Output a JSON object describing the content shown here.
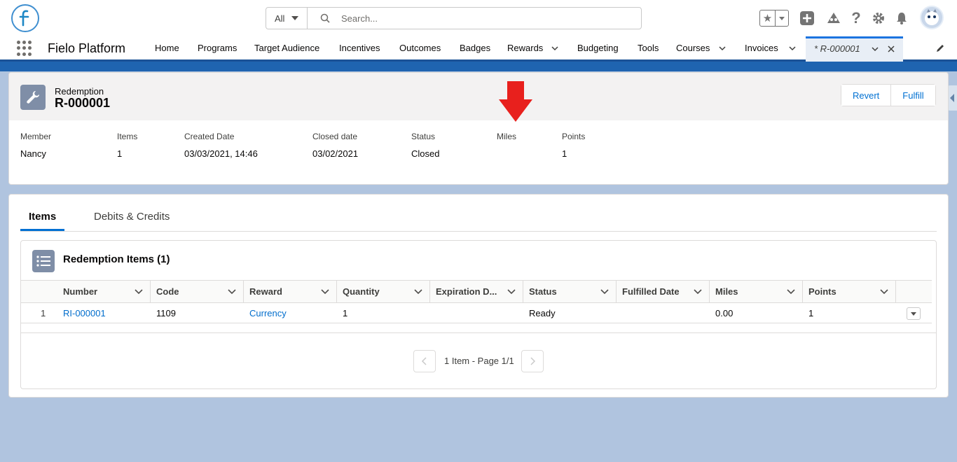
{
  "header": {
    "search_scope": "All",
    "search_placeholder": "Search..."
  },
  "nav": {
    "app_name": "Fielo Platform",
    "items": [
      {
        "label": "Home"
      },
      {
        "label": "Programs"
      },
      {
        "label": "Target Audience"
      },
      {
        "label": "Incentives"
      },
      {
        "label": "Outcomes"
      },
      {
        "label": "Badges"
      },
      {
        "label": "Rewards"
      },
      {
        "label": "Budgeting"
      },
      {
        "label": "Tools"
      },
      {
        "label": "Courses"
      },
      {
        "label": "Invoices"
      }
    ],
    "active_tab": "* R-000001"
  },
  "record": {
    "object_type": "Redemption",
    "name": "R-000001",
    "actions": {
      "revert": "Revert",
      "fulfill": "Fulfill"
    },
    "fields": [
      {
        "label": "Member",
        "value": "Nancy"
      },
      {
        "label": "Items",
        "value": "1"
      },
      {
        "label": "Created Date",
        "value": "03/03/2021, 14:46"
      },
      {
        "label": "Closed date",
        "value": "03/02/2021"
      },
      {
        "label": "Status",
        "value": "Closed"
      },
      {
        "label": "Miles",
        "value": ""
      },
      {
        "label": "Points",
        "value": "1"
      }
    ]
  },
  "tabs": [
    {
      "label": "Items",
      "active": true
    },
    {
      "label": "Debits & Credits",
      "active": false
    }
  ],
  "related": {
    "title": "Redemption Items (1)",
    "columns": [
      "Number",
      "Code",
      "Reward",
      "Quantity",
      "Expiration D...",
      "Status",
      "Fulfilled Date",
      "Miles",
      "Points"
    ],
    "rows": [
      {
        "num": "1",
        "number": "RI-000001",
        "code": "1109",
        "reward": "Currency",
        "quantity": "1",
        "expiration": "",
        "status": "Ready",
        "fulfilled": "",
        "miles": "0.00",
        "points": "1"
      }
    ],
    "pager_text": "1 Item - Page 1/1"
  },
  "colors": {
    "brand": "#0070d2",
    "annotation_arrow": "#e8201d",
    "nav_border": "#1b5297"
  },
  "icons": [
    "fielo-logo-icon",
    "search-icon",
    "star-icon",
    "plus-icon",
    "trailhead-icon",
    "help-icon",
    "gear-icon",
    "bell-icon",
    "avatar",
    "app-launcher-icon",
    "pencil-icon",
    "wrench-icon",
    "list-icon",
    "chevron-left-icon",
    "chevron-right-icon"
  ]
}
